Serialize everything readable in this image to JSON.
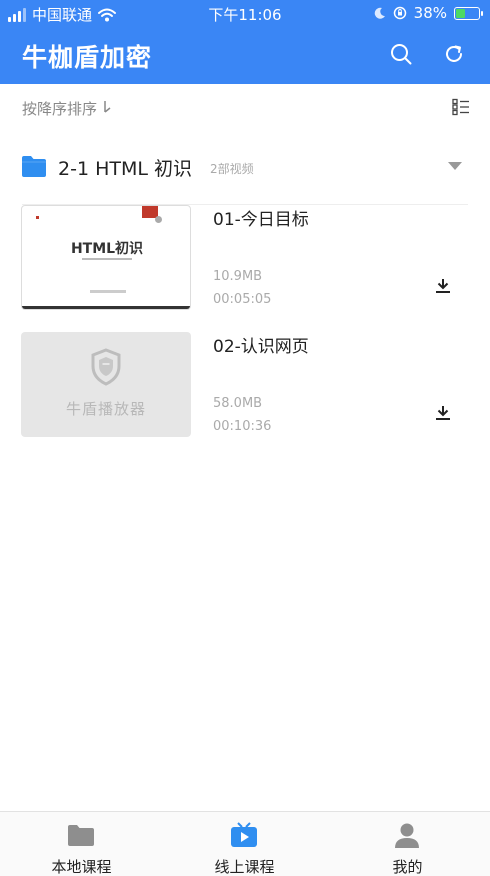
{
  "status_bar": {
    "carrier": "中国联通",
    "time": "下午11:06",
    "battery": "38%"
  },
  "header": {
    "title": "牛枷盾加密"
  },
  "sort": {
    "label": "按降序排序"
  },
  "folder": {
    "title": "2-1 HTML 初识",
    "count": "2部视频"
  },
  "videos": [
    {
      "title": "01-今日目标",
      "size": "10.9MB",
      "duration": "00:05:05",
      "thumb_title": "HTML初识"
    },
    {
      "title": "02-认识网页",
      "size": "58.0MB",
      "duration": "00:10:36",
      "thumb_label": "牛盾播放器"
    }
  ],
  "tabs": [
    {
      "label": "本地课程",
      "icon": "folder-icon"
    },
    {
      "label": "线上课程",
      "icon": "video-play-icon"
    },
    {
      "label": "我的",
      "icon": "person-icon"
    }
  ],
  "colors": {
    "brand": "#3a86f5",
    "folder": "#2f8ef0",
    "active_tab": "#2f8ef0",
    "inactive_tab": "#8e8e8e"
  }
}
